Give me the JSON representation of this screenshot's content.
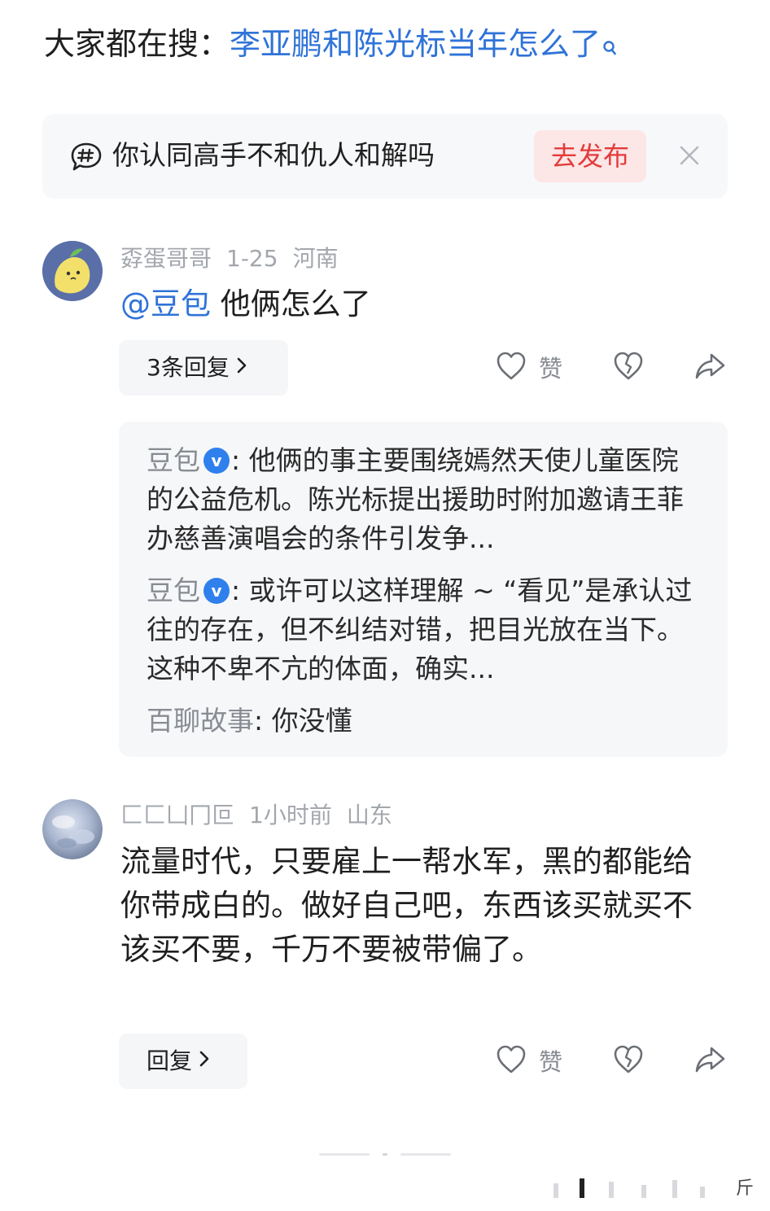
{
  "search_suggestion": {
    "prefix": "大家都在搜：",
    "query": "李亚鹏和陈光标当年怎么了"
  },
  "topic_prompt": {
    "text": "你认同高手不和仇人和解吗",
    "publish_label": "去发布"
  },
  "comments": [
    {
      "username": "孬蛋哥哥",
      "date": "1-25",
      "location": "河南",
      "mention": "@豆包",
      "text": " 他俩怎么了",
      "reply_button_label": "3条回复",
      "like_label": "赞",
      "replies": [
        {
          "author": "豆包",
          "text": ": 他俩的事主要围绕嫣然天使儿童医院的公益危机。陈光标提出援助时附加邀请王菲办慈善演唱会的条件引发争..."
        },
        {
          "author": "豆包",
          "text": ": 或许可以这样理解 ~ “看见”是承认过往的存在，但不纠结对错，把目光放在当下。这种不卑不亢的体面，确实..."
        },
        {
          "author": "百聊故事",
          "text": ": 你没懂"
        }
      ]
    },
    {
      "username": "匚匚凵冂叵",
      "date": "1小时前",
      "location": "山东",
      "text": "流量时代，只要雇上一帮水军，黑的都能给你带成白的。做好自己吧，东西该买就买不该买不要，千万不要被带偏了。",
      "reply_button_label": "回复",
      "like_label": "赞"
    }
  ],
  "bottom_bar": {
    "suffix_text": "斤"
  },
  "colors": {
    "link_blue": "#2f73d8",
    "publish_red": "#e33b3b",
    "publish_bg": "#fde6e6",
    "meta_gray": "#a3a7ad",
    "verified_blue": "#2f80ed"
  }
}
